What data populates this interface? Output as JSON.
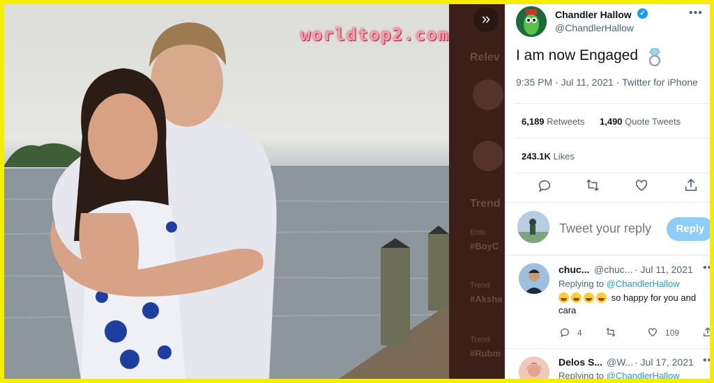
{
  "watermark": "worldtop2.com",
  "background_ghost": {
    "heading_relevant": "Relev",
    "heading_trends": "Trend",
    "items": [
      "Ente",
      "#BoyC",
      "Trend",
      "#Aksha",
      "Trend",
      "#Rubm"
    ]
  },
  "tweet": {
    "author_name": "Chandler Hallow",
    "author_handle": "@ChandlerHallow",
    "text": "I am now Engaged",
    "meta": "9:35 PM · Jul 11, 2021 · Twitter for iPhone",
    "retweets_count": "6,189",
    "retweets_label": "Retweets",
    "quotes_count": "1,490",
    "quotes_label": "Quote Tweets",
    "likes_count": "243.1K",
    "likes_label": "Likes",
    "icons": [
      "reply-icon",
      "retweet-icon",
      "like-icon",
      "share-icon"
    ]
  },
  "reply_box": {
    "placeholder": "Tweet your reply",
    "button_label": "Reply"
  },
  "comments": [
    {
      "name": "chuc...",
      "handle": "@chuc...",
      "date": "· Jul 11, 2021",
      "replying_prefix": "Replying to",
      "replying_to": "@ChandlerHallow",
      "text": "so happy for you and cara",
      "emoji_count": 4,
      "reply_count": "4",
      "like_count": "109"
    },
    {
      "name": "Delos S...",
      "handle": "@W...",
      "date": "· Jul 17, 2021",
      "replying_prefix": "Replying to",
      "replying_to": "@ChandlerHallow"
    }
  ],
  "colors": {
    "accent": "#1d9bf0",
    "border": "#f5ee00",
    "reply_button": "#8ecdf7"
  }
}
